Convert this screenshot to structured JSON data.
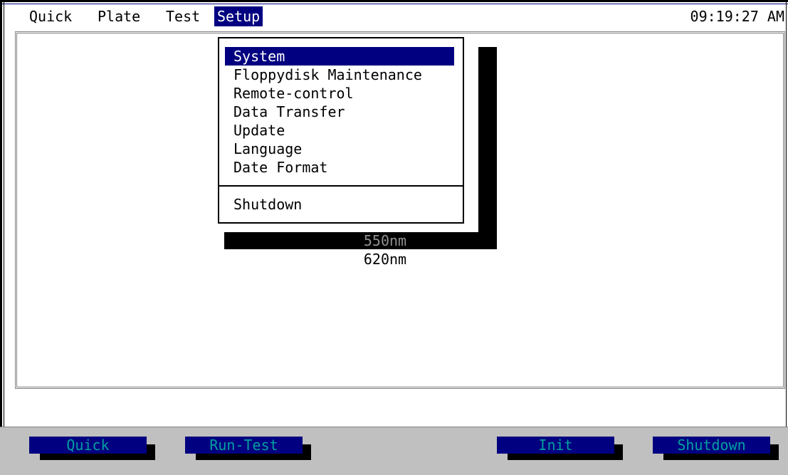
{
  "menubar": {
    "items": [
      {
        "label": "Quick",
        "active": false
      },
      {
        "label": "Plate",
        "active": false
      },
      {
        "label": "Test",
        "active": false
      },
      {
        "label": "Setup",
        "active": true
      }
    ],
    "clock": "09:19:27 AM"
  },
  "setup_menu": {
    "items": [
      {
        "label": "System",
        "selected": true
      },
      {
        "label": "Floppydisk Maintenance",
        "selected": false
      },
      {
        "label": "Remote-control",
        "selected": false
      },
      {
        "label": "Data Transfer",
        "selected": false
      },
      {
        "label": "Update",
        "selected": false
      },
      {
        "label": "Language",
        "selected": false
      },
      {
        "label": "Date Format",
        "selected": false
      }
    ],
    "footer_item": "Shutdown"
  },
  "filters": {
    "items": [
      "550nm",
      "620nm"
    ]
  },
  "footer": {
    "buttons": [
      "Quick",
      "Run-Test",
      "Init",
      "Shutdown"
    ]
  },
  "colors": {
    "highlight": "#000080",
    "footer_text": "#00a0a0",
    "footer_bg": "#c0c0c0"
  }
}
